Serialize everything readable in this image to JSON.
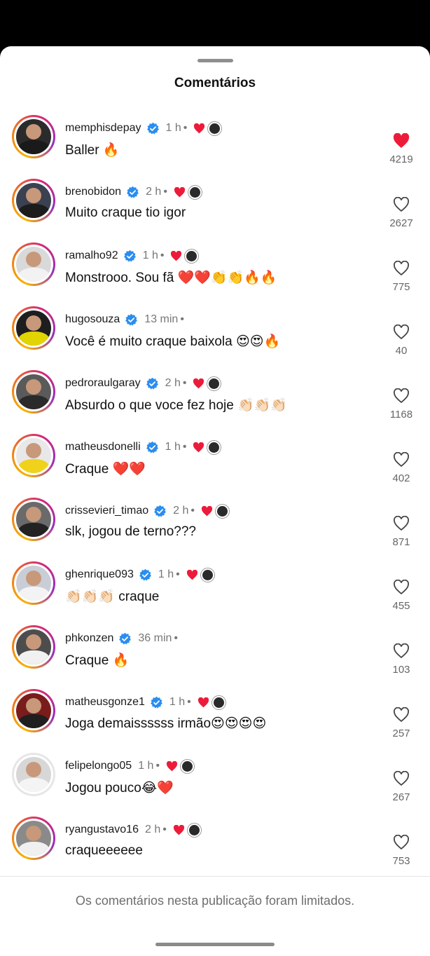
{
  "header": {
    "title": "Comentários"
  },
  "comments": [
    {
      "username": "memphisdepay",
      "verified": true,
      "time": "1 h",
      "author_liked": true,
      "text": "Baller 🔥",
      "liked": true,
      "likes": "4219",
      "ring": true,
      "avatar_bg": "#2b2b2b",
      "avatar_body": "#1a1a1a"
    },
    {
      "username": "brenobidon",
      "verified": true,
      "time": "2 h",
      "author_liked": true,
      "text": "Muito craque tio igor",
      "liked": false,
      "likes": "2627",
      "ring": true,
      "avatar_bg": "#3a4150",
      "avatar_body": "#1c1c1c"
    },
    {
      "username": "ramalho92",
      "verified": true,
      "time": "1 h",
      "author_liked": true,
      "text": "Monstrooo. Sou fã ❤️❤️👏👏🔥🔥",
      "liked": false,
      "likes": "775",
      "ring": true,
      "avatar_bg": "#d9d9d9",
      "avatar_body": "#f2f2f2"
    },
    {
      "username": "hugosouza",
      "verified": true,
      "time": "13 min",
      "author_liked": false,
      "text": "Você é muito craque baixola 😍😍🔥",
      "liked": false,
      "likes": "40",
      "ring": true,
      "avatar_bg": "#1e1e1e",
      "avatar_body": "#e2d400"
    },
    {
      "username": "pedroraulgaray",
      "verified": true,
      "time": "2 h",
      "author_liked": true,
      "text": "Absurdo o que voce fez hoje 👏🏻👏🏻👏🏻",
      "liked": false,
      "likes": "1168",
      "ring": true,
      "avatar_bg": "#5a5a5a",
      "avatar_body": "#2a2a2a"
    },
    {
      "username": "matheusdonelli",
      "verified": true,
      "time": "1 h",
      "author_liked": true,
      "text": "Craque ❤️❤️",
      "liked": false,
      "likes": "402",
      "ring": true,
      "avatar_bg": "#e8e8e8",
      "avatar_body": "#f0d21c"
    },
    {
      "username": "crissevieri_timao",
      "verified": true,
      "time": "2 h",
      "author_liked": true,
      "text": "slk, jogou de terno???",
      "liked": false,
      "likes": "871",
      "ring": true,
      "avatar_bg": "#6a6a6a",
      "avatar_body": "#222222"
    },
    {
      "username": "ghenrique093",
      "verified": true,
      "time": "1 h",
      "author_liked": true,
      "text": "👏🏻👏🏻👏🏻 craque",
      "liked": false,
      "likes": "455",
      "ring": true,
      "avatar_bg": "#c9ced6",
      "avatar_body": "#f3f3f3"
    },
    {
      "username": "phkonzen",
      "verified": true,
      "time": "36 min",
      "author_liked": false,
      "text": "Craque 🔥",
      "liked": false,
      "likes": "103",
      "ring": true,
      "avatar_bg": "#4d4d4d",
      "avatar_body": "#f1f1f1"
    },
    {
      "username": "matheusgonze1",
      "verified": true,
      "time": "1 h",
      "author_liked": true,
      "text": "Joga demaissssss irmão😍😍😍😍",
      "liked": false,
      "likes": "257",
      "ring": true,
      "avatar_bg": "#7a1c1c",
      "avatar_body": "#1f1f1f"
    },
    {
      "username": "felipelongo05",
      "verified": false,
      "time": "1 h",
      "author_liked": true,
      "text": "Jogou pouco😂❤️",
      "liked": false,
      "likes": "267",
      "ring": false,
      "avatar_bg": "#d7d7d7",
      "avatar_body": "#f4f4f4"
    },
    {
      "username": "ryangustavo16",
      "verified": false,
      "time": "2 h",
      "author_liked": true,
      "text": "craqueeeeee",
      "liked": false,
      "likes": "753",
      "ring": true,
      "avatar_bg": "#8a8a8a",
      "avatar_body": "#f0f0f0"
    }
  ],
  "footer": {
    "note": "Os comentários nesta publicação foram limitados."
  },
  "colors": {
    "heart_red": "#ed1b3a",
    "verified_blue": "#2a8df0"
  },
  "icons": {
    "verified": "verified-badge-icon",
    "like": "heart-icon",
    "author_like": "heart-filled-icon"
  }
}
